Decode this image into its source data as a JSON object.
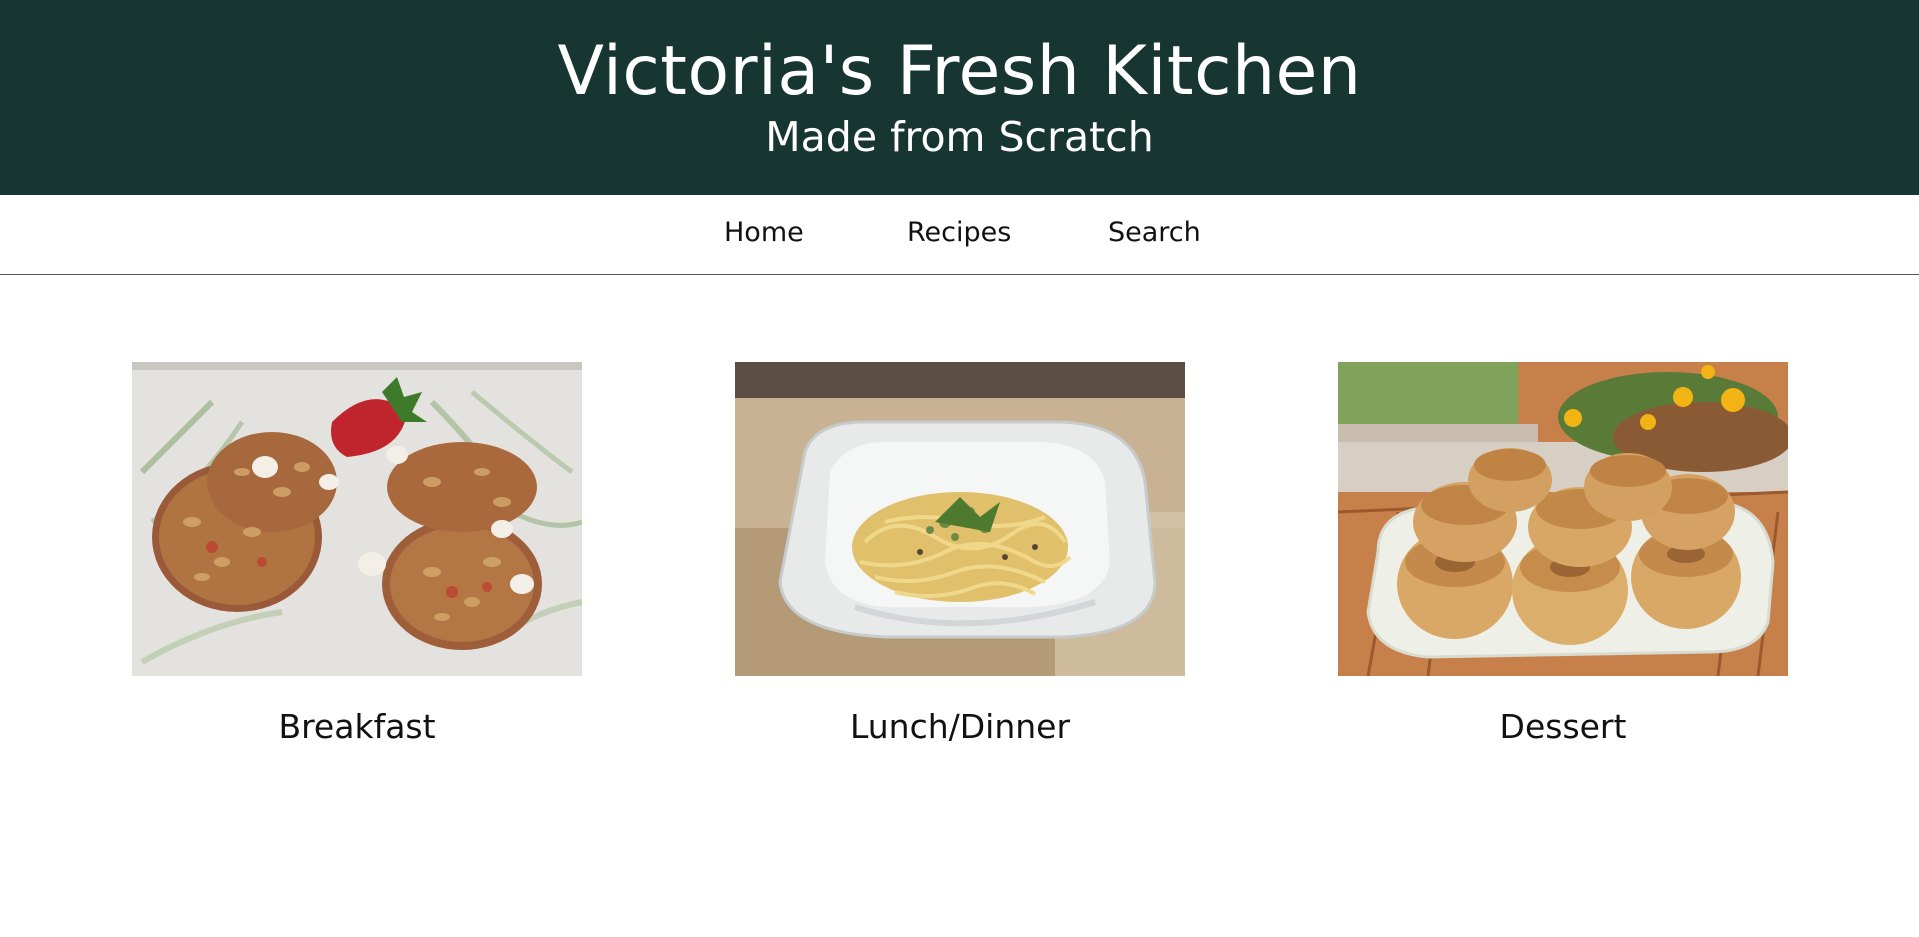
{
  "header": {
    "title": "Victoria's Fresh Kitchen",
    "subtitle": "Made from Scratch",
    "background_color": "#173632"
  },
  "nav": {
    "items": [
      {
        "label": "Home"
      },
      {
        "label": "Recipes"
      },
      {
        "label": "Search"
      }
    ]
  },
  "categories": [
    {
      "label": "Breakfast",
      "image": "oatmeal-cookies-photo"
    },
    {
      "label": "Lunch/Dinner",
      "image": "pasta-bowl-photo"
    },
    {
      "label": "Dessert",
      "image": "cinnamon-rolls-photo"
    }
  ]
}
